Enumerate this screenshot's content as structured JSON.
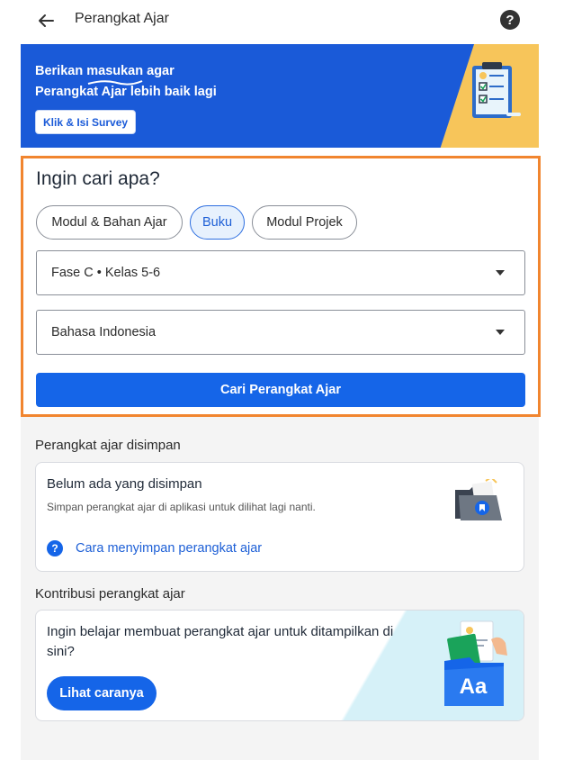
{
  "header": {
    "title": "Perangkat Ajar",
    "back_icon": "arrow-left-icon",
    "help_icon": "question-circle-icon",
    "help_glyph": "?"
  },
  "banner": {
    "line1_before": "Berikan ",
    "line1_underlined": "masukan",
    "line1_after": " agar",
    "line2": "Perangkat Ajar lebih baik lagi",
    "button_label": "Klik & Isi Survey",
    "bg_color": "#1a5ad8",
    "accent_color": "#f7c55a",
    "illustration_icon": "clipboard-checklist-icon"
  },
  "search": {
    "heading": "Ingin cari apa?",
    "chips": [
      {
        "label": "Modul & Bahan Ajar",
        "selected": false
      },
      {
        "label": "Buku",
        "selected": true
      },
      {
        "label": "Modul Projek",
        "selected": false
      }
    ],
    "phase_select": {
      "value": "Fase C • Kelas 5-6"
    },
    "subject_select": {
      "value": "Bahasa Indonesia"
    },
    "button_label": "Cari Perangkat Ajar",
    "highlight_color": "#f1852f",
    "primary_color": "#1565e8"
  },
  "saved": {
    "section_label": "Perangkat ajar disimpan",
    "card_title": "Belum ada yang disimpan",
    "card_subtitle": "Simpan perangkat ajar di aplikasi untuk dilihat lagi nanti.",
    "help_link": "Cara menyimpan perangkat ajar",
    "help_glyph": "?",
    "illustration_icon": "folder-bookmark-icon"
  },
  "contribution": {
    "section_label": "Kontribusi perangkat ajar",
    "card_text": "Ingin belajar membuat perangkat ajar untuk ditampilkan di sini?",
    "button_label": "Lihat caranya",
    "illustration_icon": "aa-document-icon",
    "illustration_text": "Aa"
  }
}
